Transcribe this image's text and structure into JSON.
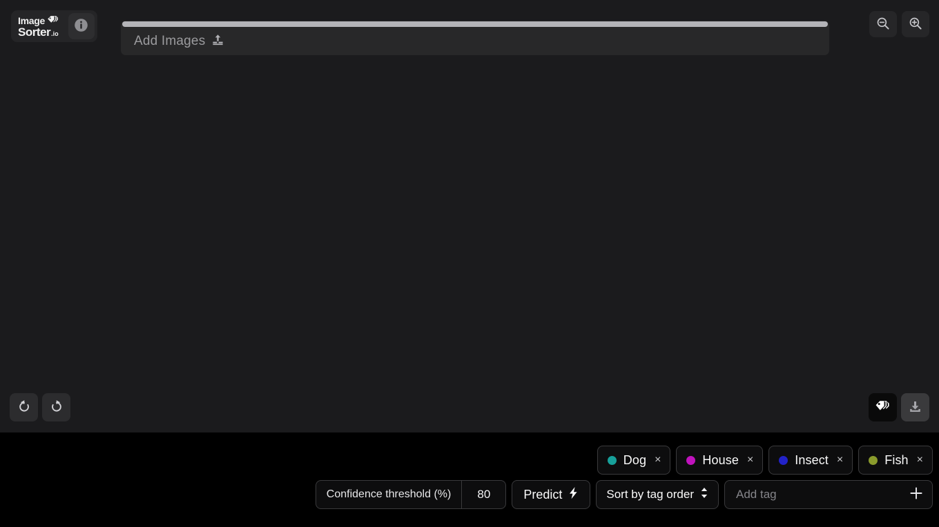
{
  "app": {
    "brand_image": "Image",
    "brand_sorter": "Sorter",
    "brand_tld": ".io"
  },
  "header": {
    "info_icon": "info-circle-icon",
    "logo_tag_icon": "tag-icon",
    "zoom_out_label": "zoom-out-icon",
    "zoom_in_label": "zoom-in-icon"
  },
  "dropzone": {
    "label": "Add Images",
    "upload_icon": "upload-icon"
  },
  "history": {
    "undo_icon": "undo-icon",
    "redo_icon": "redo-icon"
  },
  "panel_toggles": {
    "tags_icon": "tags-icon",
    "download_icon": "download-icon"
  },
  "tags": [
    {
      "name": "Dog",
      "color": "#17a09a",
      "remove": "×"
    },
    {
      "name": "House",
      "color": "#c013bd",
      "remove": "×"
    },
    {
      "name": "Insect",
      "color": "#2222c8",
      "remove": "×"
    },
    {
      "name": "Fish",
      "color": "#8a9b2c",
      "remove": "×"
    }
  ],
  "controls": {
    "confidence_label": "Confidence threshold (%)",
    "confidence_value": "80",
    "predict_label": "Predict",
    "predict_icon": "lightning-bolt-icon",
    "sort_label": "Sort by tag order",
    "sort_icon": "up-down-chevron-icon",
    "add_tag_placeholder": "Add tag",
    "add_tag_value": "",
    "add_tag_plus_icon": "plus-icon"
  }
}
